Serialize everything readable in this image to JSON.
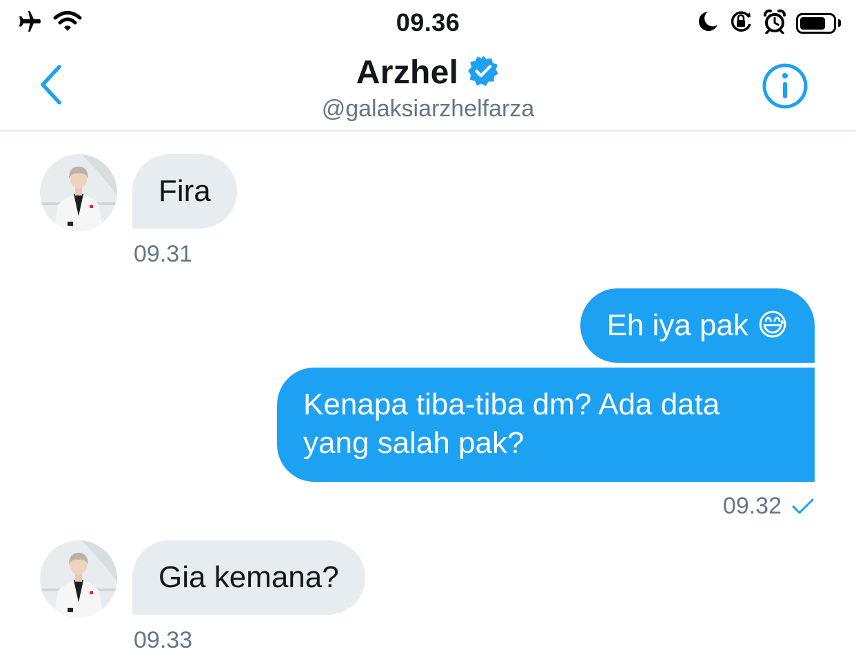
{
  "status_bar": {
    "time": "09.36",
    "left_icons": [
      "airplane-icon",
      "wifi-icon"
    ],
    "right_icons": [
      "moon-icon",
      "orientation-lock-icon",
      "alarm-icon",
      "battery-icon"
    ]
  },
  "header": {
    "name": "Arzhel",
    "handle": "@galaksiarzhelfarza",
    "verified": true,
    "accent_color": "#1da1f2"
  },
  "messages": [
    {
      "direction": "in",
      "text": "Fira",
      "time": "09.31"
    },
    {
      "direction": "out",
      "text": "Eh iya pak 😅"
    },
    {
      "direction": "out",
      "text": "Kenapa tiba-tiba dm? Ada data yang salah pak?",
      "time": "09.32",
      "status": "sent-check"
    },
    {
      "direction": "in",
      "text": "Gia kemana?",
      "time": "09.33"
    }
  ],
  "colors": {
    "incoming_bubble": "#e6ecf0",
    "outgoing_bubble": "#1da1f2",
    "timestamp": "#657786",
    "divider": "#e1e8ed"
  }
}
